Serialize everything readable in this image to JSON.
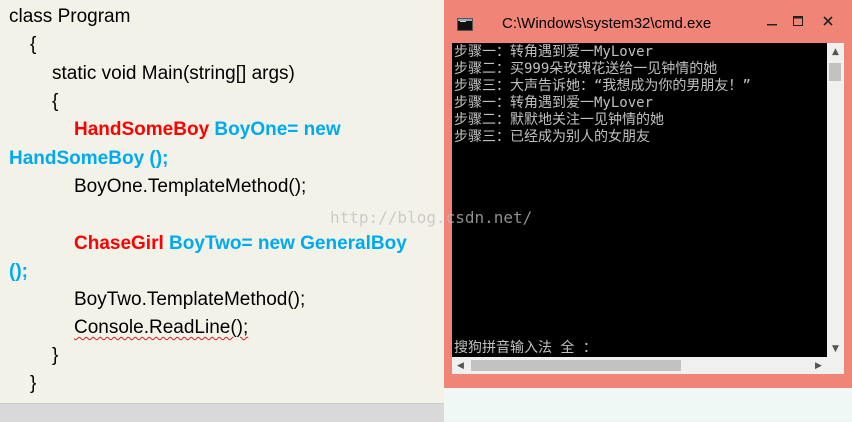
{
  "code": {
    "lines": [
      "class Program",
      "{",
      "static void Main(string[] args)",
      "{",
      "HandSomeBoy",
      "BoyOne= new",
      "HandSomeBoy ();",
      "BoyOne.TemplateMethod();",
      "ChaseGirl",
      "BoyTwo= new GeneralBoy",
      "();",
      "BoyTwo.TemplateMethod();",
      "Console.ReadLine();",
      "}",
      "}"
    ]
  },
  "cmd": {
    "title": "C:\\Windows\\system32\\cmd.exe",
    "output": [
      "步骤一：转角遇到爱一MyLover",
      "步骤二：买999朵玫瑰花送给一见钟情的她",
      "步骤三：大声告诉她：“我想成为你的男朋友！”",
      "步骤一：转角遇到爱一MyLover",
      "步骤二：默默地关注一见钟情的她",
      "步骤三：已经成为别人的女朋友"
    ],
    "ime_status": "搜狗拼音输入法 全 ："
  },
  "watermark": "http://blog.csdn.net/",
  "colors": {
    "titlebar": "#f08577",
    "console_bg": "#000000",
    "console_text": "#c0c0c0",
    "keyword_red": "#ff0000",
    "keyword_blue": "#00aaee"
  },
  "icons": {
    "app": "cmd-app-icon",
    "minimize": "minimize-icon",
    "maximize": "maximize-icon",
    "close": "close-icon"
  }
}
